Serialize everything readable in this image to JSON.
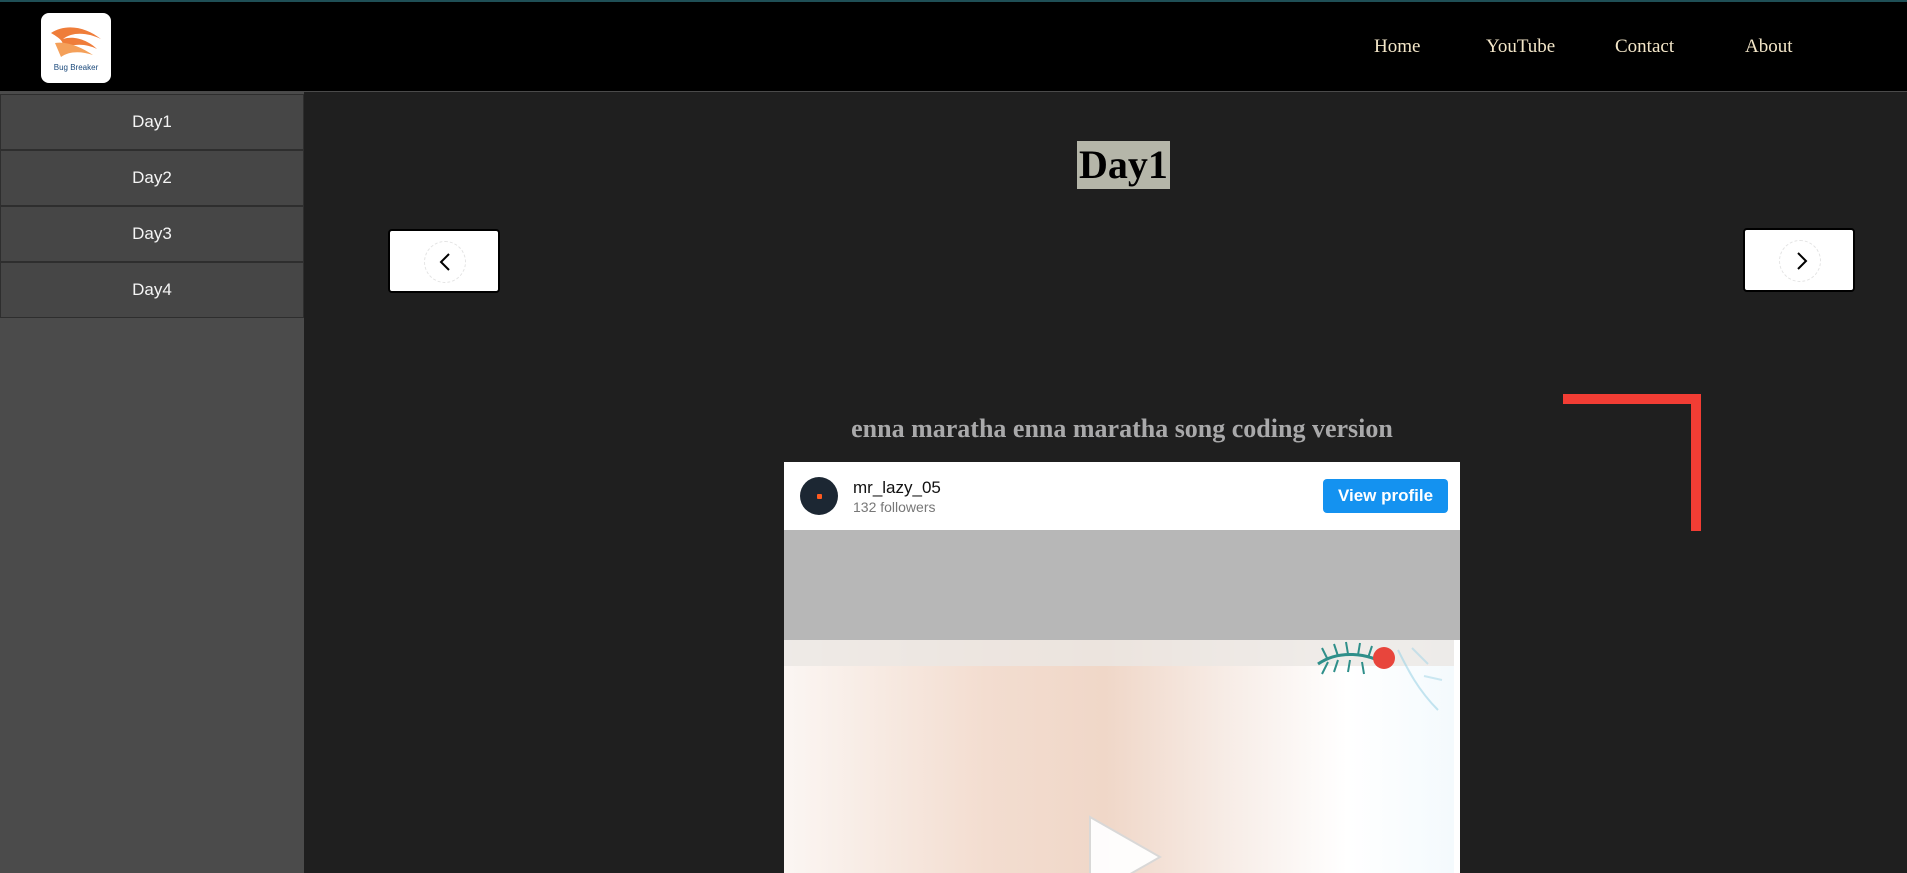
{
  "header": {
    "logo_text": "Bug Breaker",
    "nav": [
      "Home",
      "YouTube",
      "Contact",
      "About"
    ]
  },
  "sidebar": {
    "items": [
      "Day1",
      "Day2",
      "Day3",
      "Day4"
    ]
  },
  "main": {
    "day_title": "Day1",
    "prev_icon": "chevron-left-icon",
    "next_icon": "chevron-right-icon",
    "post_title": "enna maratha enna maratha song coding version"
  },
  "embed": {
    "username": "mr_lazy_05",
    "followers": "132 followers",
    "view_profile_label": "View profile"
  },
  "colors": {
    "accent_red": "#f23d34",
    "button_blue": "#1492f0",
    "nav_text": "#f3e6c8",
    "title_highlight": "#b5b6a9"
  }
}
